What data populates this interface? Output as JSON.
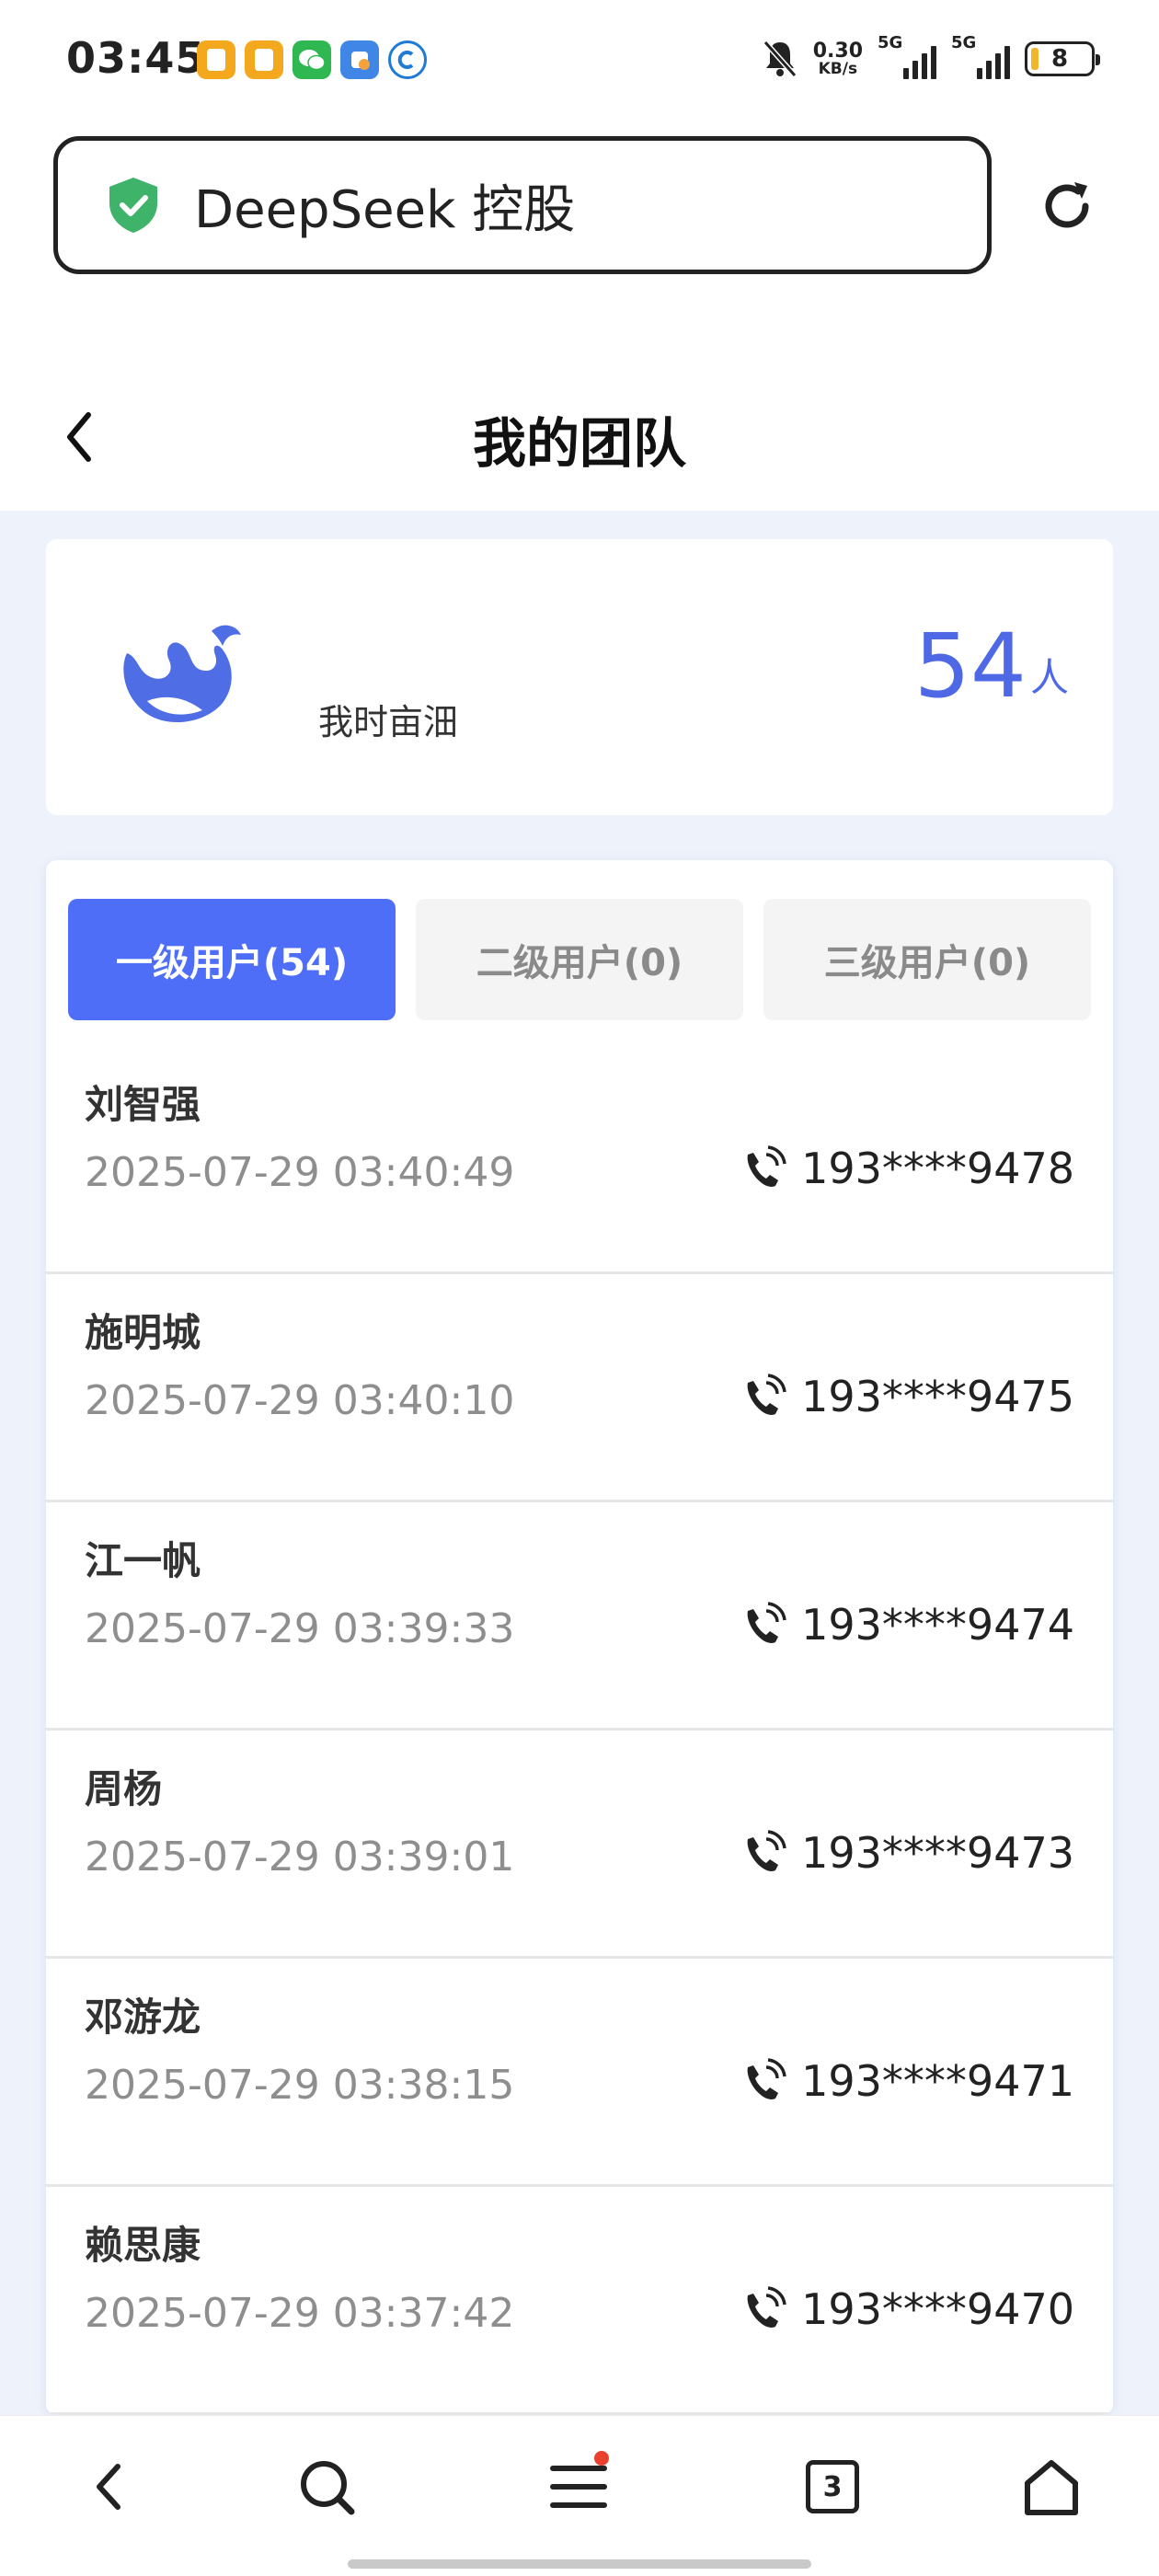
{
  "status_bar": {
    "time": "03:45",
    "net_speed_value": "0.30",
    "net_speed_unit": "KB/s",
    "signal1_label": "5G",
    "signal2_label": "5G",
    "battery": "8"
  },
  "browser": {
    "address_title": "DeepSeek 控股"
  },
  "header": {
    "title": "我的团队"
  },
  "summary": {
    "name": "我时亩沺",
    "count": "54",
    "count_unit": "人",
    "accent_color": "#4f69e6"
  },
  "tabs": [
    {
      "label": "一级用户(54)",
      "active": true
    },
    {
      "label": "二级用户(0)",
      "active": false
    },
    {
      "label": "三级用户(0)",
      "active": false
    }
  ],
  "members": [
    {
      "name": "刘智强",
      "date": "2025-07-29 03:40:49",
      "phone": "193****9478"
    },
    {
      "name": "施明城",
      "date": "2025-07-29 03:40:10",
      "phone": "193****9475"
    },
    {
      "name": "江一帆",
      "date": "2025-07-29 03:39:33",
      "phone": "193****9474"
    },
    {
      "name": "周杨",
      "date": "2025-07-29 03:39:01",
      "phone": "193****9473"
    },
    {
      "name": "邓游龙",
      "date": "2025-07-29 03:38:15",
      "phone": "193****9471"
    },
    {
      "name": "赖思康",
      "date": "2025-07-29 03:37:42",
      "phone": "193****9470"
    }
  ],
  "bottom_nav": {
    "tab_count": "3",
    "icons": [
      "back-icon",
      "search-icon",
      "menu-icon",
      "tabs-icon",
      "home-icon"
    ]
  }
}
